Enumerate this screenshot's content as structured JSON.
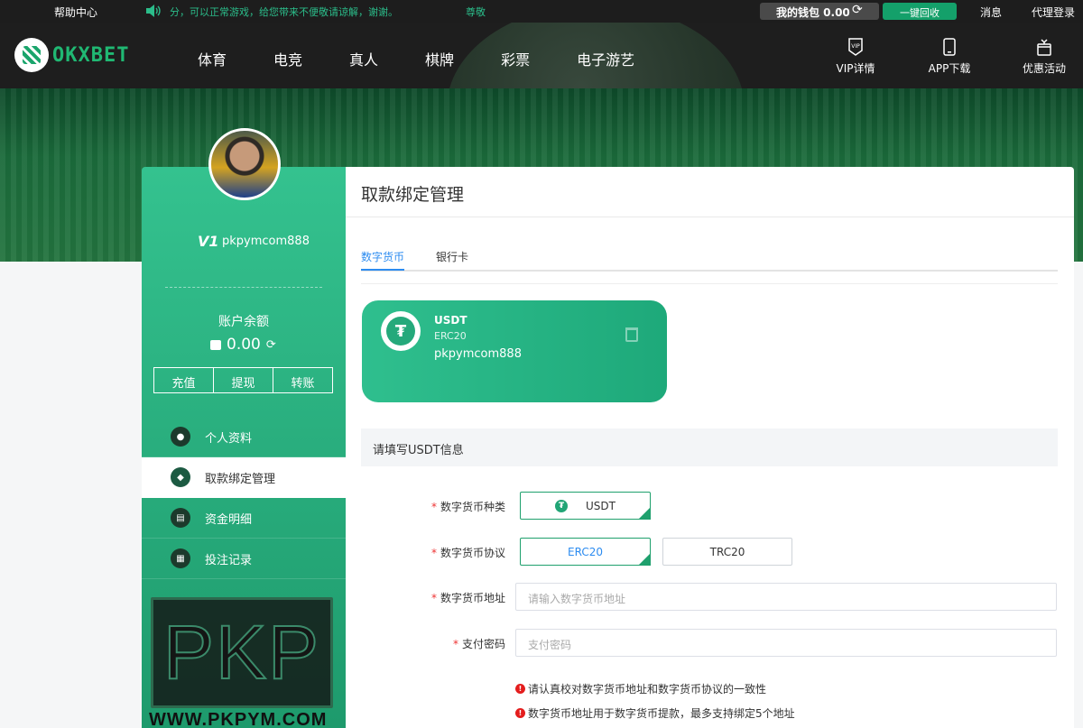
{
  "topbar": {
    "help": "帮助中心",
    "notice": "分，可以正常游戏，给您带来不便敬请谅解，谢谢。",
    "notice_tail": "尊敬",
    "wallet": "我的钱包 0.00",
    "recycle": "一键回收",
    "messages": "消息",
    "agent_login": "代理登录"
  },
  "header": {
    "logo_text": "OKXBET",
    "nav": [
      "体育",
      "电竞",
      "真人",
      "棋牌",
      "彩票",
      "电子游艺"
    ],
    "vip": "VIP详情",
    "app": "APP下载",
    "promo": "优惠活动"
  },
  "sidebar": {
    "level": "V1",
    "username": "pkpymcom888",
    "balance_label": "账户余额",
    "balance": "0.00",
    "actions": [
      "充值",
      "提现",
      "转账"
    ],
    "menu": [
      {
        "label": "个人资料",
        "icon": "user-icon"
      },
      {
        "label": "取款绑定管理",
        "icon": "shield-icon",
        "active": true
      },
      {
        "label": "资金明细",
        "icon": "ledger-icon"
      },
      {
        "label": "投注记录",
        "icon": "calendar-icon"
      }
    ]
  },
  "watermark": {
    "logo": "PKP",
    "url": "WWW.PKPYM.COM"
  },
  "main": {
    "title": "取款绑定管理",
    "tabs": [
      "数字货币",
      "银行卡"
    ],
    "card": {
      "coin": "USDT",
      "protocol": "ERC20",
      "account": "pkpymcom888"
    },
    "section_title": "请填写USDT信息",
    "form": {
      "currency_type_label": "数字货币种类",
      "currency_type_value": "USDT",
      "protocol_label": "数字货币协议",
      "protocol_options": [
        "ERC20",
        "TRC20"
      ],
      "address_label": "数字货币地址",
      "address_placeholder": "请输入数字货币地址",
      "password_label": "支付密码",
      "password_placeholder": "支付密码"
    },
    "notes": [
      "请认真校对数字货币地址和数字货币协议的一致性",
      "数字货币地址用于数字货币提款，最多支持绑定5个地址"
    ]
  },
  "colors": {
    "accent": "#1fa06d",
    "tab_active": "#2d8cf0",
    "required": "#e33333"
  }
}
